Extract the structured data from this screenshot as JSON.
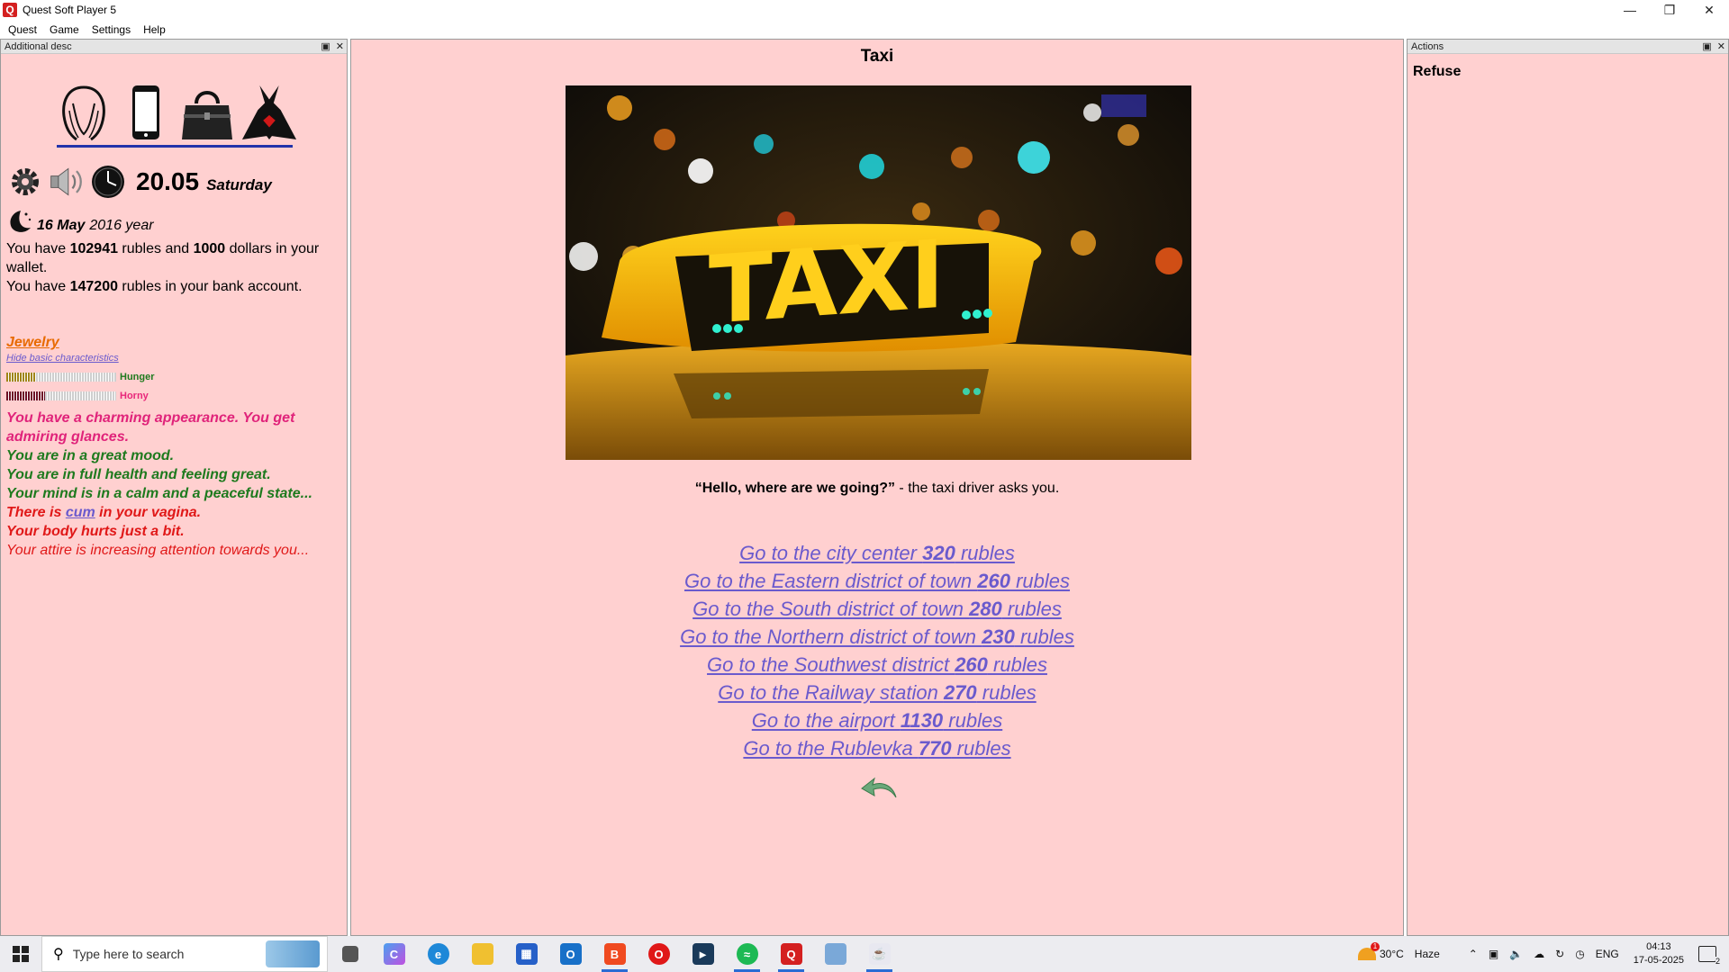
{
  "window": {
    "title": "Quest Soft Player 5",
    "logo_letter": "Q"
  },
  "menu": [
    "Quest",
    "Game",
    "Settings",
    "Help"
  ],
  "left_panel": {
    "header": "Additional desc",
    "top_icons": [
      "face-icon",
      "phone-icon",
      "handbag-icon",
      "dress-icon"
    ],
    "tool_icons": [
      "gear-icon",
      "speaker-icon",
      "clock-icon"
    ],
    "time": "20.05",
    "weekday": "Saturday",
    "date": "16 May",
    "year_text": "2016 year",
    "wallet": {
      "prefix": "You have ",
      "rubles": "102941",
      "mid": " rubles and ",
      "dollars": "1000",
      "suffix": " dollars in your wallet."
    },
    "bank": {
      "prefix": "You have ",
      "rubles": "147200",
      "suffix": " rubles in your bank account."
    },
    "jewelry_link": "Jewelry",
    "hide_link": "Hide basic characteristics",
    "stats": [
      {
        "label": "Hunger",
        "level": 0.27,
        "fill_color": "#a08418",
        "label_color": "#1e7a1e"
      },
      {
        "label": "Horny",
        "level": 0.35,
        "fill_color": "#6e1026",
        "label_color": "#e8277a"
      }
    ],
    "status": {
      "appearance": "You have a charming appearance. You get admiring glances.",
      "mood": "You are in a great mood.",
      "health": "You are in full health and feeling great.",
      "mind": "Your mind is in a calm and a peaceful state...",
      "cum_pre": "There is ",
      "cum_link": "cum",
      "cum_post": " in your vagina.",
      "pain": "Your body hurts just  a bit.",
      "attire": "Your attire is increasing attention towards you..."
    },
    "colors": {
      "pink": "#e0237a",
      "green": "#1e7a1e",
      "red": "#e01818",
      "link": "#6a5acd",
      "orange": "#e86a00"
    }
  },
  "center": {
    "title": "Taxi",
    "image_sign_text": "TAXI",
    "dialogue_speech": "“Hello, where are we going?”",
    "dialogue_rest": " - the taxi driver asks you.",
    "options": [
      {
        "pre": "Go to the city center ",
        "price": "320",
        "post": " rubles"
      },
      {
        "pre": "Go to the Eastern district of town ",
        "price": "260",
        "post": " rubles"
      },
      {
        "pre": "Go to the South district of town ",
        "price": "280",
        "post": " rubles"
      },
      {
        "pre": "Go to the Northern district of town ",
        "price": "230",
        "post": " rubles"
      },
      {
        "pre": "Go to the Southwest district ",
        "price": "260",
        "post": " rubles"
      },
      {
        "pre": "Go to the Railway station ",
        "price": "270",
        "post": " rubles"
      },
      {
        "pre": "Go to the airport ",
        "price": "1130",
        "post": " rubles"
      },
      {
        "pre": "Go to the Rublevka ",
        "price": "770",
        "post": " rubles"
      }
    ]
  },
  "right_panel": {
    "header": "Actions",
    "actions": [
      "Refuse"
    ]
  },
  "taskbar": {
    "search_placeholder": "Type here to search",
    "apps": [
      "task-view-icon",
      "copilot-icon",
      "edge-icon",
      "file-explorer-icon",
      "store-icon",
      "outlook-icon",
      "brave-icon",
      "opera-icon",
      "vpn-icon",
      "spotify-icon",
      "quest-player-icon",
      "photos-icon",
      "java-icon"
    ],
    "weather_temp": "30°C",
    "weather_desc": "Haze",
    "weather_badge": "1",
    "language": "ENG",
    "time": "04:13",
    "date": "17-05-2025",
    "notification_count": "2"
  }
}
